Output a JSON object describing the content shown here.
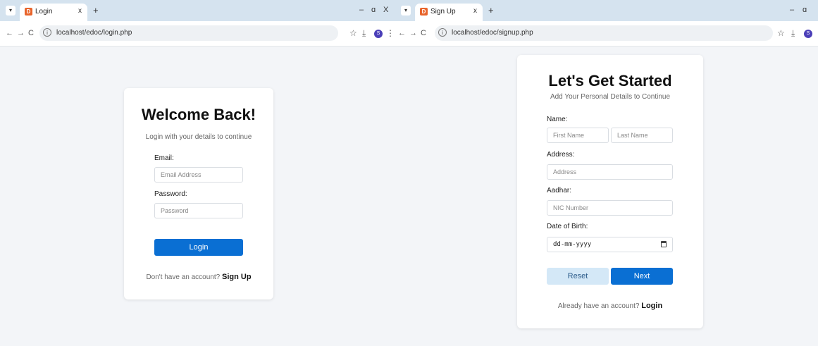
{
  "left_window": {
    "tab_title": "Login",
    "url": "localhost/edoc/login.php",
    "form": {
      "heading": "Welcome Back!",
      "subheading": "Login with your details to continue",
      "email_label": "Email:",
      "email_placeholder": "Email Address",
      "password_label": "Password:",
      "password_placeholder": "Password",
      "login_button": "Login",
      "footer_text": "Don't have an account?",
      "footer_link": "Sign Up"
    }
  },
  "right_window": {
    "tab_title": "Sign Up",
    "url": "localhost/edoc/signup.php",
    "form": {
      "heading": "Let's Get Started",
      "subheading": "Add Your Personal Details to Continue",
      "name_label": "Name:",
      "first_name_placeholder": "First Name",
      "last_name_placeholder": "Last Name",
      "address_label": "Address:",
      "address_placeholder": "Address",
      "aadhar_label": "Aadhar:",
      "nic_placeholder": "NIC Number",
      "dob_label": "Date of Birth:",
      "dob_placeholder": "dd-mm-yyyy",
      "reset_button": "Reset",
      "next_button": "Next",
      "footer_text": "Already have an account?",
      "footer_link": "Login"
    }
  },
  "browser": {
    "new_tab": "+",
    "minimize": "–",
    "restore": "ɑ",
    "close": "X",
    "back": "←",
    "forward": "→",
    "reload": "C",
    "info": "i",
    "star": "☆",
    "download": "⤓",
    "profile": "S",
    "menu": "⋮",
    "favicon": "D",
    "tab_close": "x",
    "tab_dropdown": "▾"
  },
  "colors": {
    "primary_button": "#0a6fd3",
    "secondary_button": "#d4e8f7",
    "tab_strip": "#d5e3ef",
    "favicon": "#e8642b"
  }
}
